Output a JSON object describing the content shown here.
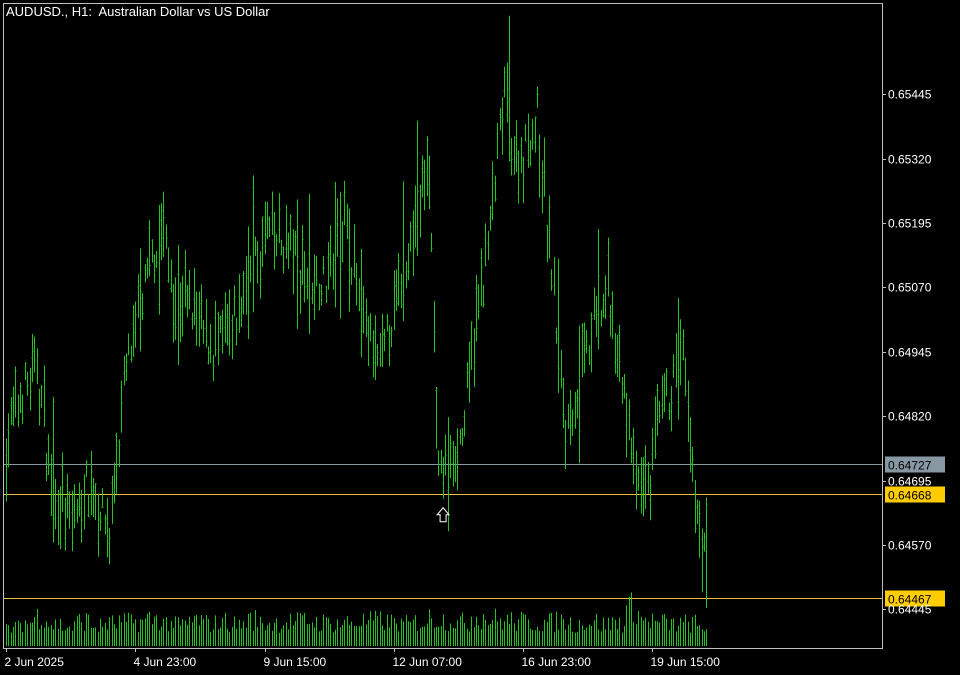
{
  "title": "AUDUSD., H1:  Australian Dollar vs US Dollar",
  "colors": {
    "background": "#000000",
    "frame": "#c0c0c0",
    "bars": "#22c322",
    "volume": "#22c322",
    "text": "#ffffff",
    "hline_grey": "#8a9aa5",
    "hline_yellow": "#e8c14a",
    "label_yellow_bg": "#ffcc00",
    "label_grey_bg": "#8798a3",
    "arrow": "#ffffff"
  },
  "chart_data": {
    "type": "bar",
    "timeframe": "H1",
    "ylim": [
      0.6437,
      0.6562
    ],
    "y_ticks": [
      "0.65445",
      "0.65320",
      "0.65195",
      "0.65070",
      "0.64945",
      "0.64820",
      "0.64695",
      "0.64570",
      "0.64445"
    ],
    "x_ticks": [
      {
        "label": "2 Jun 2025",
        "bar": 0
      },
      {
        "label": "4 Jun 23:00",
        "bar": 55
      },
      {
        "label": "9 Jun 15:00",
        "bar": 110
      },
      {
        "label": "12 Jun 07:00",
        "bar": 165
      },
      {
        "label": "16 Jun 23:00",
        "bar": 220
      },
      {
        "label": "19 Jun 15:00",
        "bar": 275
      }
    ],
    "horizontal_lines": [
      {
        "price": 0.64727,
        "label": "0.64727",
        "style": "grey"
      },
      {
        "price": 0.64668,
        "label": "0.64668",
        "style": "yellow"
      },
      {
        "price": 0.64467,
        "label": "0.64467",
        "style": "yellow"
      }
    ],
    "arrow_marker": {
      "bar": 186,
      "price": 0.6465
    },
    "anchors": [
      [
        0,
        0.6477
      ],
      [
        6,
        0.6486
      ],
      [
        13,
        0.6492
      ],
      [
        20,
        0.6466
      ],
      [
        28,
        0.6462
      ],
      [
        36,
        0.647
      ],
      [
        44,
        0.6458
      ],
      [
        50,
        0.6488
      ],
      [
        58,
        0.6505
      ],
      [
        66,
        0.6518
      ],
      [
        72,
        0.6506
      ],
      [
        80,
        0.6502
      ],
      [
        88,
        0.6495
      ],
      [
        96,
        0.6498
      ],
      [
        104,
        0.651
      ],
      [
        112,
        0.6518
      ],
      [
        120,
        0.6514
      ],
      [
        128,
        0.651
      ],
      [
        136,
        0.6508
      ],
      [
        144,
        0.652
      ],
      [
        152,
        0.65
      ],
      [
        160,
        0.6492
      ],
      [
        168,
        0.6508
      ],
      [
        176,
        0.6525
      ],
      [
        180,
        0.653
      ],
      [
        184,
        0.647
      ],
      [
        188,
        0.6472
      ],
      [
        194,
        0.6478
      ],
      [
        200,
        0.65
      ],
      [
        206,
        0.6518
      ],
      [
        212,
        0.6545
      ],
      [
        218,
        0.653
      ],
      [
        226,
        0.654
      ],
      [
        232,
        0.651
      ],
      [
        238,
        0.648
      ],
      [
        244,
        0.6488
      ],
      [
        250,
        0.65
      ],
      [
        256,
        0.6505
      ],
      [
        262,
        0.649
      ],
      [
        268,
        0.6468
      ],
      [
        274,
        0.647
      ],
      [
        280,
        0.6485
      ],
      [
        288,
        0.6492
      ],
      [
        292,
        0.647
      ],
      [
        298,
        0.6452
      ]
    ],
    "volumes": [
      20,
      26,
      33,
      24,
      21,
      28,
      22,
      25,
      26,
      27,
      30,
      26,
      23,
      28,
      25,
      27,
      24,
      29,
      25,
      26,
      27,
      28,
      26,
      25,
      26,
      27,
      28,
      26,
      24,
      27,
      31,
      29,
      26,
      33,
      30,
      28,
      27,
      26,
      26,
      28,
      25,
      27,
      24,
      26,
      42,
      28,
      26,
      24,
      25,
      20
    ]
  }
}
